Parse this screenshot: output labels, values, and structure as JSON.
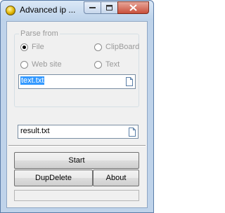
{
  "window": {
    "title": "Advanced ip ..."
  },
  "parse_from": {
    "legend": "Parse from",
    "options": [
      {
        "label": "File",
        "selected": true
      },
      {
        "label": "ClipBoard",
        "selected": false
      },
      {
        "label": "Web site",
        "selected": false
      },
      {
        "label": "Text",
        "selected": false
      }
    ],
    "input_value": "text.txt"
  },
  "output": {
    "value": "result.txt"
  },
  "buttons": {
    "start": "Start",
    "dupdelete": "DupDelete",
    "about": "About"
  },
  "icons": {
    "app": "app-icon",
    "minimize": "minimize-icon",
    "maximize": "maximize-icon",
    "close": "close-icon",
    "browse": "document-icon"
  },
  "colors": {
    "title_bar": "#bfd3ea",
    "close_button": "#c9503b",
    "selection": "#3399ff"
  }
}
